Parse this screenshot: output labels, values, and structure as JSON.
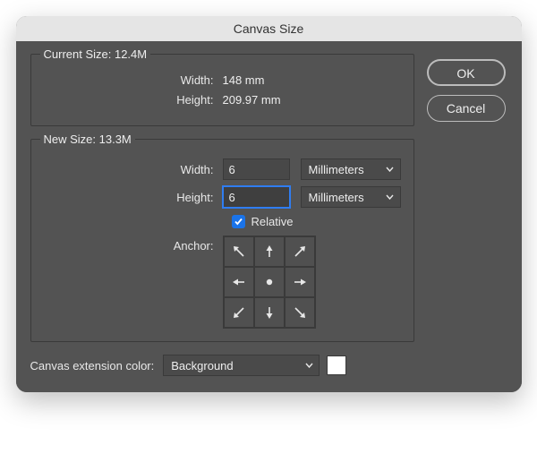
{
  "title": "Canvas Size",
  "buttons": {
    "ok": "OK",
    "cancel": "Cancel"
  },
  "current": {
    "title": "Current Size: 12.4M",
    "width_label": "Width:",
    "width_value": "148 mm",
    "height_label": "Height:",
    "height_value": "209.97 mm"
  },
  "newsize": {
    "title": "New Size: 13.3M",
    "width_label": "Width:",
    "width_value": "6",
    "width_units": "Millimeters",
    "height_label": "Height:",
    "height_value": "6",
    "height_units": "Millimeters",
    "relative_label": "Relative",
    "anchor_label": "Anchor:"
  },
  "extension": {
    "label": "Canvas extension color:",
    "value": "Background",
    "swatch": "#ffffff"
  }
}
